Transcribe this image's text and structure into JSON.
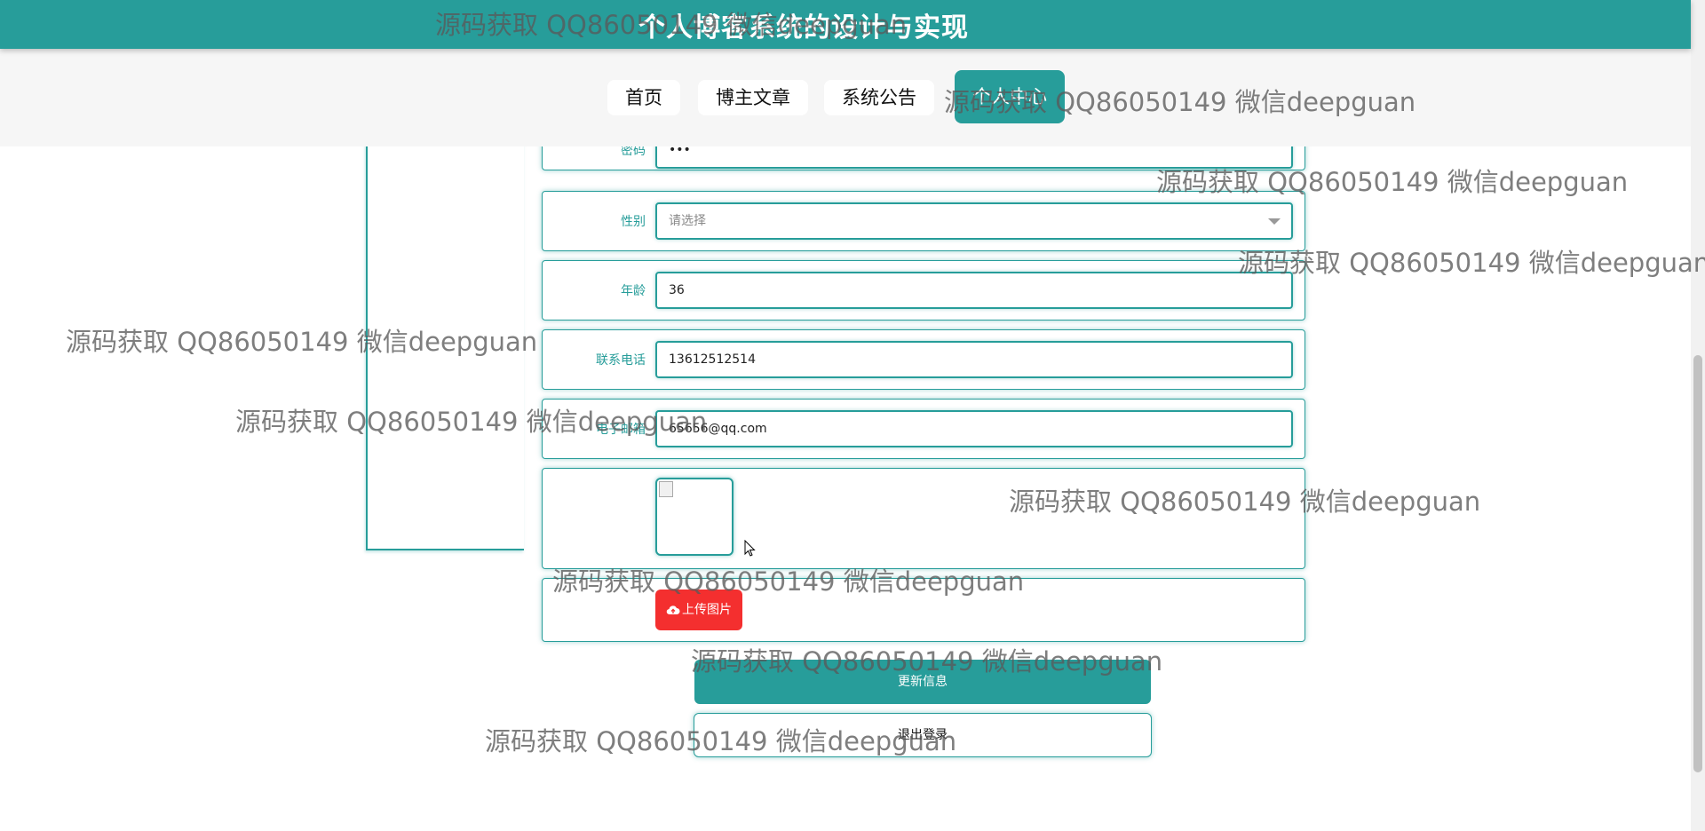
{
  "header": {
    "title": "个人博客系统的设计与实现"
  },
  "nav": {
    "items": [
      {
        "label": "首页"
      },
      {
        "label": "博主文章"
      },
      {
        "label": "系统公告"
      },
      {
        "label": "个人中心"
      }
    ]
  },
  "form": {
    "password": {
      "label": "密码",
      "value": "•••"
    },
    "gender": {
      "label": "性别",
      "placeholder": "请选择"
    },
    "age": {
      "label": "年龄",
      "value": "36"
    },
    "phone": {
      "label": "联系电话",
      "value": "13612512514"
    },
    "email": {
      "label": "电子邮箱",
      "value": "65656@qq.com"
    },
    "upload_label": "上传图片"
  },
  "buttons": {
    "update": "更新信息",
    "logout": "退出登录"
  },
  "watermark": "源码获取 QQ86050149 微信deepguan",
  "colors": {
    "primary": "#279d9a",
    "upload": "#f42f2f"
  }
}
